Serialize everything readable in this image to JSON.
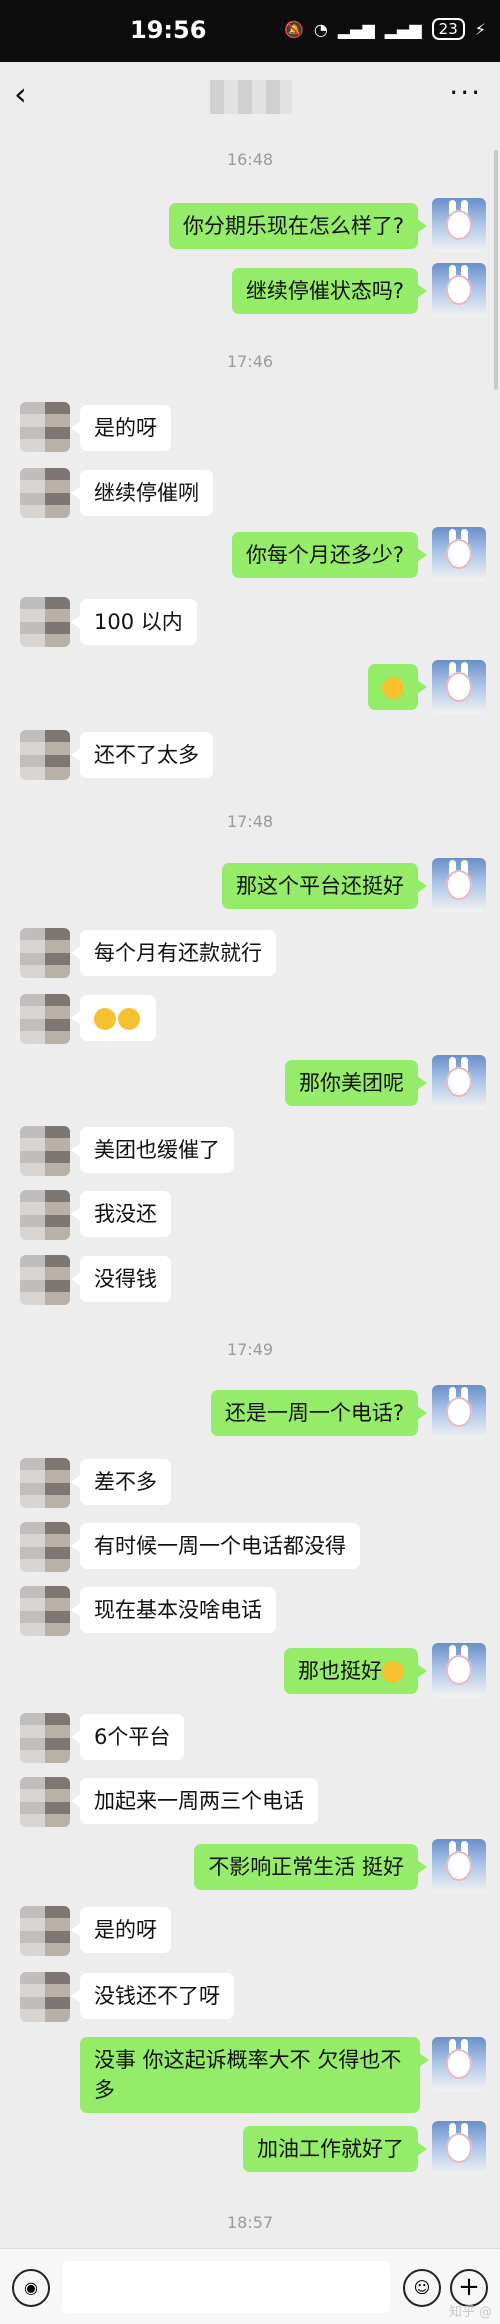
{
  "status_bar": {
    "time": "19:56",
    "battery": "23"
  },
  "header": {
    "contact_name": ""
  },
  "timestamps": [
    "16:48",
    "17:46",
    "17:48",
    "17:49",
    "18:57"
  ],
  "messages": [
    {
      "side": "out",
      "text": "你分期乐现在怎么样了?"
    },
    {
      "side": "out",
      "text": "继续停催状态吗?"
    },
    {
      "side": "in",
      "text": "是的呀"
    },
    {
      "side": "in",
      "text": "继续停催咧"
    },
    {
      "side": "out",
      "text": "你每个月还多少?"
    },
    {
      "side": "in",
      "text": "100 以内"
    },
    {
      "side": "out",
      "text": "",
      "emoji": "smile-emoji"
    },
    {
      "side": "in",
      "text": "还不了太多"
    },
    {
      "side": "out",
      "text": "那这个平台还挺好"
    },
    {
      "side": "in",
      "text": "每个月有还款就行"
    },
    {
      "side": "in",
      "text": "",
      "emoji": "laugh-cry-emoji x2"
    },
    {
      "side": "out",
      "text": "那你美团呢"
    },
    {
      "side": "in",
      "text": "美团也缓催了"
    },
    {
      "side": "in",
      "text": "我没还"
    },
    {
      "side": "in",
      "text": "没得钱"
    },
    {
      "side": "out",
      "text": "还是一周一个电话?"
    },
    {
      "side": "in",
      "text": "差不多"
    },
    {
      "side": "in",
      "text": "有时候一周一个电话都没得"
    },
    {
      "side": "in",
      "text": "现在基本没啥电话"
    },
    {
      "side": "out",
      "text": "那也挺好",
      "emoji": "smile-emoji"
    },
    {
      "side": "in",
      "text": "6个平台"
    },
    {
      "side": "in",
      "text": "加起来一周两三个电话"
    },
    {
      "side": "out",
      "text": "不影响正常生活 挺好"
    },
    {
      "side": "in",
      "text": "是的呀"
    },
    {
      "side": "in",
      "text": "没钱还不了呀"
    },
    {
      "side": "out",
      "text": "没事 你这起诉概率大不 欠得也不多"
    },
    {
      "side": "out",
      "text": "加油工作就好了"
    }
  ],
  "watermark": "知乎 @"
}
